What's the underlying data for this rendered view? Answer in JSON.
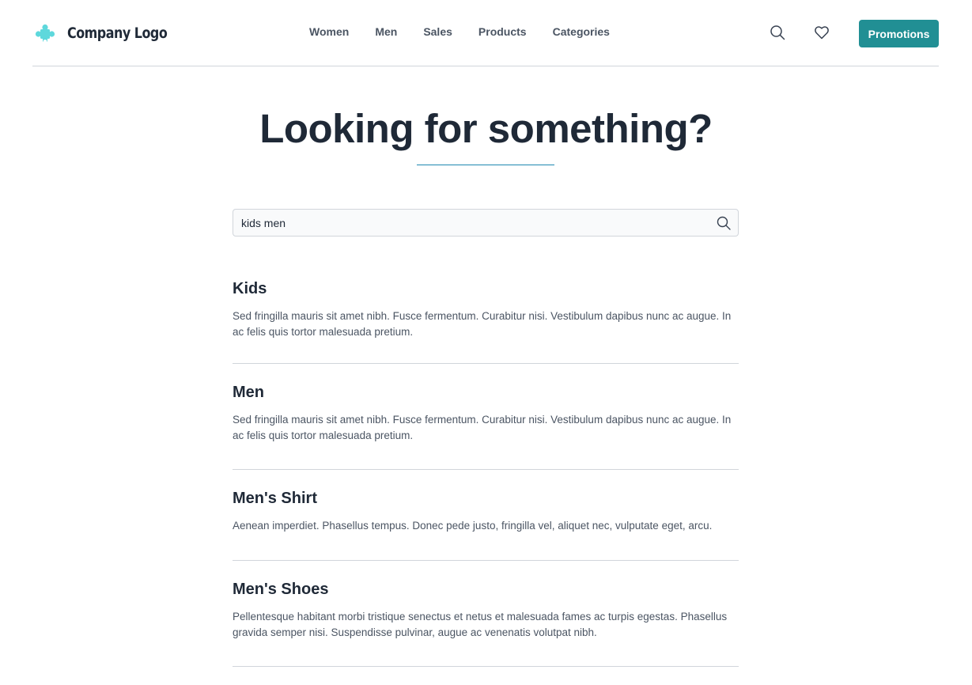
{
  "header": {
    "logo_text": "Company Logo",
    "nav": [
      "Women",
      "Men",
      "Sales",
      "Products",
      "Categories"
    ],
    "icons": [
      "search-icon",
      "heart-icon"
    ],
    "promo_label": "Promotions"
  },
  "main": {
    "title": "Looking for something?",
    "search": {
      "value": "kids men"
    },
    "results": [
      {
        "title": "Kids",
        "description": "Sed fringilla mauris sit amet nibh. Fusce fermentum. Curabitur nisi. Vestibulum dapibus nunc ac augue. In ac felis quis tortor malesuada pretium."
      },
      {
        "title": "Men",
        "description": "Sed fringilla mauris sit amet nibh. Fusce fermentum. Curabitur nisi. Vestibulum dapibus nunc ac augue. In ac felis quis tortor malesuada pretium."
      },
      {
        "title": "Men's Shirt",
        "description": "Aenean imperdiet. Phasellus tempus. Donec pede justo, fringilla vel, aliquet nec, vulputate eget, arcu."
      },
      {
        "title": "Men's Shoes",
        "description": "Pellentesque habitant morbi tristique senectus et netus et malesuada fames ac turpis egestas. Phasellus gravida semper nisi. Suspendisse pulvinar, augue ac venenatis volutpat nibh."
      }
    ]
  },
  "colors": {
    "accent": "#218f94",
    "logo_icon": "#5ed8dc",
    "title_underline": "#1e88b0",
    "text_dark": "#1f2937",
    "text_muted": "#4b5563",
    "divider": "#d1d5db"
  }
}
